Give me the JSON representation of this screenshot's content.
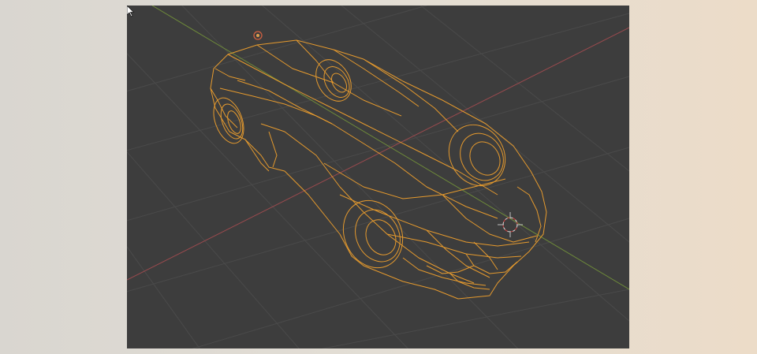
{
  "viewport": {
    "background_color": "#3d3d3d",
    "grid_color": "#4a4a4a",
    "x_axis_color": "#9a4a4e",
    "y_axis_color": "#6e8a3a",
    "wireframe_color": "#e59a2e",
    "cursor_3d_colors": [
      "#e0e0e0",
      "#d04040"
    ]
  },
  "icons": {
    "light_object": "light-icon",
    "origin_cursor": "3d-cursor-icon",
    "mouse_pointer": "mouse-pointer-icon"
  },
  "scene": {
    "object_type": "wireframe-car"
  }
}
